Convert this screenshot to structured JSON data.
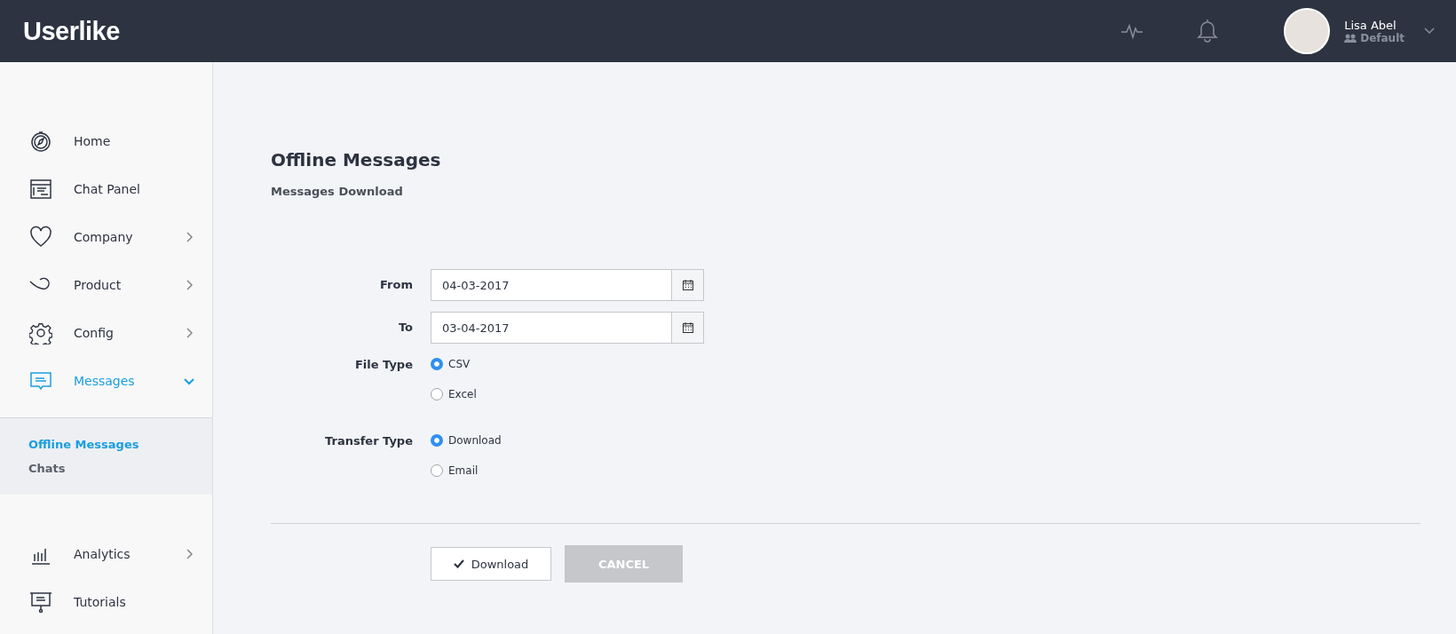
{
  "header": {
    "logo": "Userlike",
    "user": {
      "name": "Lisa Abel",
      "group": "Default"
    }
  },
  "sidebar": {
    "items": [
      {
        "label": "Home",
        "selected": false,
        "kind": "link"
      },
      {
        "label": "Chat Panel",
        "selected": false,
        "kind": "link"
      },
      {
        "label": "Company",
        "selected": false,
        "kind": "group",
        "expanded": false
      },
      {
        "label": "Product",
        "selected": false,
        "kind": "group",
        "expanded": false
      },
      {
        "label": "Config",
        "selected": false,
        "kind": "group",
        "expanded": false
      },
      {
        "label": "Messages",
        "selected": true,
        "kind": "group",
        "expanded": true,
        "children": [
          {
            "label": "Offline Messages",
            "selected": true
          },
          {
            "label": "Chats",
            "selected": false
          }
        ]
      },
      {
        "label": "Analytics",
        "selected": false,
        "kind": "group",
        "expanded": false
      },
      {
        "label": "Tutorials",
        "selected": false,
        "kind": "link"
      }
    ]
  },
  "page": {
    "title": "Offline Messages",
    "subtitle": "Messages Download",
    "date_fields": [
      {
        "label": "From",
        "value": "04-03-2017"
      },
      {
        "label": "To",
        "value": "03-04-2017"
      }
    ],
    "radio_groups": [
      {
        "label": "File Type",
        "options": [
          {
            "label": "CSV",
            "selected": true
          },
          {
            "label": "Excel",
            "selected": false
          }
        ]
      },
      {
        "label": "Transfer Type",
        "options": [
          {
            "label": "Download",
            "selected": true
          },
          {
            "label": "Email",
            "selected": false
          }
        ]
      }
    ],
    "buttons": [
      {
        "label": "Download",
        "kind": "secondary",
        "disabled": false
      },
      {
        "label": "CANCEL",
        "kind": "primary",
        "disabled": true
      }
    ]
  }
}
